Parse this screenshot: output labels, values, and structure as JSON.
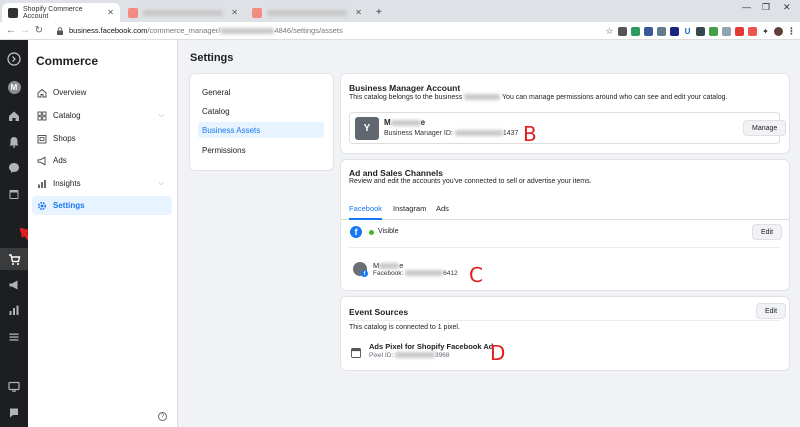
{
  "browser": {
    "active_tab_title": "Shopify Commerce Account",
    "url_host": "business.facebook.com",
    "url_path_prefix": "/commerce_manager/",
    "url_path_suffix": "4846/settings/assets"
  },
  "leftnav": {
    "title": "Commerce",
    "items": [
      {
        "label": "Overview"
      },
      {
        "label": "Catalog"
      },
      {
        "label": "Shops"
      },
      {
        "label": "Ads"
      },
      {
        "label": "Insights"
      },
      {
        "label": "Settings"
      }
    ],
    "help": "?"
  },
  "page": {
    "title": "Settings"
  },
  "settings_menu": {
    "items": [
      {
        "label": "General"
      },
      {
        "label": "Catalog"
      },
      {
        "label": "Business Assets"
      },
      {
        "label": "Permissions"
      }
    ]
  },
  "business_manager": {
    "title": "Business Manager Account",
    "subtitle_prefix": "This catalog belongs to the business",
    "subtitle_suffix": "You can manage permissions around who can see and edit your catalog.",
    "avatar_letter": "Y",
    "name_start": "M",
    "name_end": "e",
    "id_label": "Business Manager ID:",
    "id_end": "1437",
    "manage_label": "Manage"
  },
  "ad_sales": {
    "title": "Ad and Sales Channels",
    "subtitle": "Review and edit the accounts you've connected to sell or advertise your items.",
    "tabs": [
      {
        "label": "Facebook"
      },
      {
        "label": "Instagram"
      },
      {
        "label": "Ads"
      }
    ],
    "status": "Visible",
    "edit_label": "Edit",
    "page_name_start": "M",
    "page_name_end": "e",
    "page_label": "Facebook:",
    "page_id_end": "6412"
  },
  "event_sources": {
    "title": "Event Sources",
    "subtitle": "This catalog is connected to 1 pixel.",
    "edit_label": "Edit",
    "pixel_name": "Ads Pixel for Shopify Facebook Ad",
    "pixel_label": "Pixel ID:",
    "pixel_id_end": "3968"
  },
  "annotations": {
    "b": "B",
    "c": "C",
    "d": "D"
  },
  "colors": {
    "accent": "#1877f2",
    "rail": "#1c1e21",
    "annotation": "#e02020"
  }
}
